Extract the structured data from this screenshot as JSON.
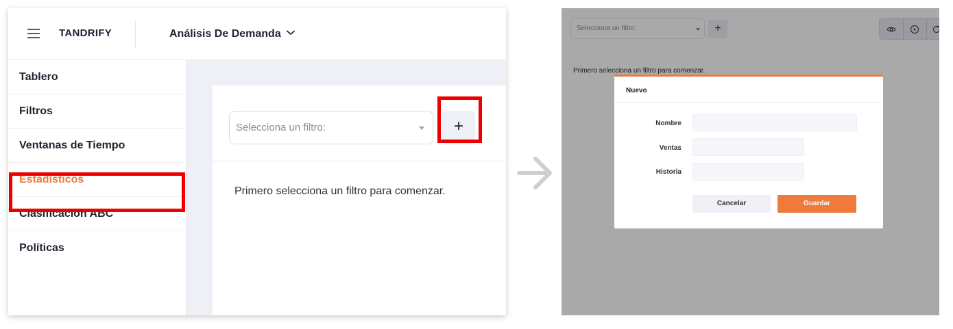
{
  "left": {
    "header": {
      "brand": "TANDRIFY",
      "module_title": "Análisis De Demanda",
      "icons": {
        "menu": "menu-icon",
        "module_dropdown": "chevron-down-icon"
      }
    },
    "sidebar": {
      "active_item": "Estadísticos",
      "items": [
        {
          "label": "Tablero"
        },
        {
          "label": "Filtros"
        },
        {
          "label": "Ventanas de Tiempo"
        },
        {
          "label": "Estadísticos"
        },
        {
          "label": "Clasificación ABC"
        },
        {
          "label": "Políticas"
        }
      ]
    },
    "filter": {
      "select_placeholder": "Selecciona un filtro:",
      "add_label": "+",
      "empty_message": "Primero selecciona un filtro para comenzar."
    }
  },
  "right": {
    "toolbar": {
      "select_placeholder": "Selecciona un filtro:",
      "add_label": "+",
      "icons": [
        "eye-icon",
        "play-icon",
        "refresh-icon"
      ]
    },
    "empty_message": "Primero selecciona un filtro para comenzar.",
    "modal": {
      "title": "Nuevo",
      "fields": [
        {
          "label": "Nombre",
          "value": ""
        },
        {
          "label": "Ventas",
          "value": ""
        },
        {
          "label": "Historia",
          "value": ""
        }
      ],
      "cancel_label": "Cancelar",
      "save_label": "Guardar"
    }
  },
  "colors": {
    "accent": "#ee7a3c",
    "highlight": "#ee0000",
    "overlay": "#a9a9a9",
    "content_background": "#eef0f6",
    "arrow": "#cfcfcf"
  },
  "arrow_icon": "arrow-right-icon"
}
